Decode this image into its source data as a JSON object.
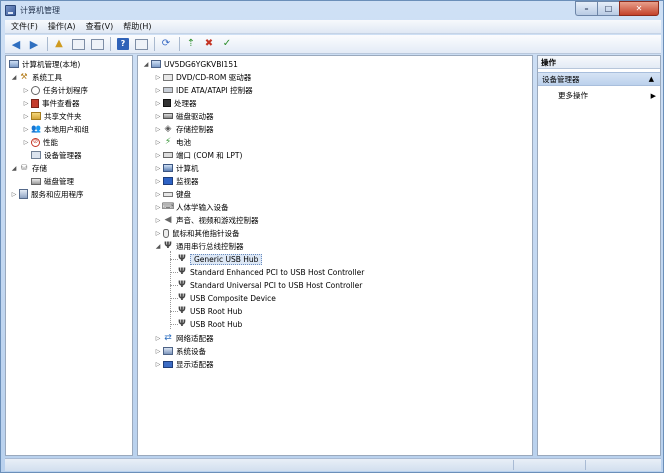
{
  "window": {
    "title": "计算机管理",
    "buttons": {
      "minimize": "–",
      "maximize": "□",
      "close": "✕"
    }
  },
  "menubar": [
    {
      "name": "menu-file",
      "label": "文件(F)"
    },
    {
      "name": "menu-action",
      "label": "操作(A)"
    },
    {
      "name": "menu-view",
      "label": "查看(V)"
    },
    {
      "name": "menu-help",
      "label": "帮助(H)"
    }
  ],
  "left_tree": {
    "root": "计算机管理(本地)",
    "system_tools": "系统工具",
    "task_scheduler": "任务计划程序",
    "event_viewer": "事件查看器",
    "shared_folders": "共享文件夹",
    "local_users": "本地用户和组",
    "performance": "性能",
    "device_manager": "设备管理器",
    "storage": "存储",
    "disk_management": "磁盘管理",
    "services_apps": "服务和应用程序"
  },
  "device_tree": {
    "computer": "UV5DG6YGKVBI151",
    "categories": {
      "dvd": "DVD/CD-ROM 驱动器",
      "ide": "IDE ATA/ATAPI 控制器",
      "processor": "处理器",
      "disk": "磁盘驱动器",
      "storage_ctrl": "存储控制器",
      "battery": "电池",
      "ports": "端口 (COM 和 LPT)",
      "computer": "计算机",
      "monitor": "监视器",
      "keyboard": "键盘",
      "hid": "人体学输入设备",
      "sound": "声音、视频和游戏控制器",
      "mouse": "鼠标和其他指针设备",
      "usb": "通用串行总线控制器",
      "network": "网络适配器",
      "system": "系统设备",
      "display": "显示适配器"
    },
    "usb_children": [
      "Generic USB Hub",
      "Standard Enhanced PCI to USB Host Controller",
      "Standard Universal PCI to USB Host Controller",
      "USB Composite Device",
      "USB Root Hub",
      "USB Root Hub"
    ]
  },
  "actions": {
    "header": "操作",
    "section": "设备管理器",
    "more": "更多操作"
  }
}
